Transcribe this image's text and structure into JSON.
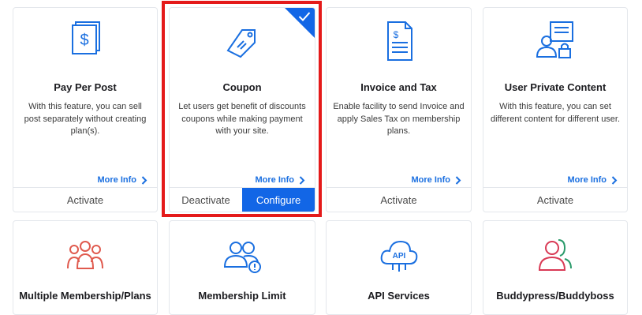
{
  "accent_color": "#1266e6",
  "highlight_color": "#e41a1a",
  "cards": [
    {
      "title": "Pay Per Post",
      "description": "With this feature, you can sell post separately without creating plan(s).",
      "more_info": "More Info",
      "action": "Activate",
      "icon": "dollar-document-icon"
    },
    {
      "title": "Coupon",
      "description": "Let users get benefit of discounts coupons while making payment with your site.",
      "more_info": "More Info",
      "deactivate": "Deactivate",
      "configure": "Configure",
      "icon": "coupon-tag-icon",
      "active": true
    },
    {
      "title": "Invoice and Tax",
      "description": "Enable facility to send Invoice and apply Sales Tax on membership plans.",
      "more_info": "More Info",
      "action": "Activate",
      "icon": "invoice-icon"
    },
    {
      "title": "User Private Content",
      "description": "With this feature, you can set different content for different user.",
      "more_info": "More Info",
      "action": "Activate",
      "icon": "private-content-icon"
    }
  ],
  "cards_row2": [
    {
      "title": "Multiple Membership/Plans",
      "icon": "multiple-members-icon"
    },
    {
      "title": "Membership Limit",
      "icon": "members-limit-icon"
    },
    {
      "title": "API Services",
      "icon": "api-cloud-icon"
    },
    {
      "title": "Buddypress/Buddyboss",
      "icon": "buddy-users-icon"
    }
  ]
}
